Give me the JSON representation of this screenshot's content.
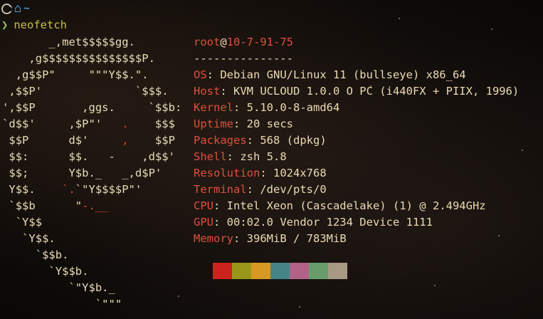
{
  "prompt": {
    "tilde": "~",
    "chevron": "❯",
    "command": "neofetch"
  },
  "ascii_art": [
    "       _,met$$$$$gg.",
    "    ,g$$$$$$$$$$$$$$$P.",
    "  ,g$$P\"     \"\"\"Y$$.\".",
    " ,$$P'              `$$$.",
    "',$$P       ,ggs.     `$$b:",
    "`d$$'     ,$P\"'   .    $$$",
    " $$P      d$'     ,    $$P",
    " $$:      $$.   -    ,d$$'",
    " $$;      Y$b._   _,d$P'",
    " Y$$.    `.`\"Y$$$$P\"'",
    " `$$b      \"-.__",
    "  `Y$$",
    "   `Y$$.",
    "     `$$b.",
    "       `Y$$b.",
    "          `\"Y$b._",
    "              `\"\"\""
  ],
  "info": {
    "user": "root",
    "at": "@",
    "host": "10-7-91-75",
    "separator": "---------------",
    "rows": [
      {
        "key": "OS",
        "value": "Debian GNU/Linux 11 (bullseye) x86_64"
      },
      {
        "key": "Host",
        "value": "KVM UCLOUD 1.0.0 O PC (i440FX + PIIX, 1996)"
      },
      {
        "key": "Kernel",
        "value": "5.10.0-8-amd64"
      },
      {
        "key": "Uptime",
        "value": "20 secs"
      },
      {
        "key": "Packages",
        "value": "568 (dpkg)"
      },
      {
        "key": "Shell",
        "value": "zsh 5.8"
      },
      {
        "key": "Resolution",
        "value": "1024x768"
      },
      {
        "key": "Terminal",
        "value": "/dev/pts/0"
      },
      {
        "key": "CPU",
        "value": "Intel Xeon (Cascadelake) (1) @ 2.494GHz"
      },
      {
        "key": "GPU",
        "value": "00:02.0 Vendor 1234 Device 1111"
      },
      {
        "key": "Memory",
        "value": "396MiB / 783MiB"
      }
    ],
    "key_separator": ": "
  },
  "colors": {
    "accent_red": "#e0503c",
    "text": "#ebdbb2",
    "prompt_blue": "#4a9ad8",
    "prompt_green": "#8ec07c",
    "command_yellow": "#c8c04a"
  },
  "palette": [
    "#cc241d",
    "#98971a",
    "#d79921",
    "#458588",
    "#b16286",
    "#689d6a",
    "#a89984"
  ],
  "icons": {
    "distro": "debian-swirl-icon",
    "home": "home-icon"
  }
}
